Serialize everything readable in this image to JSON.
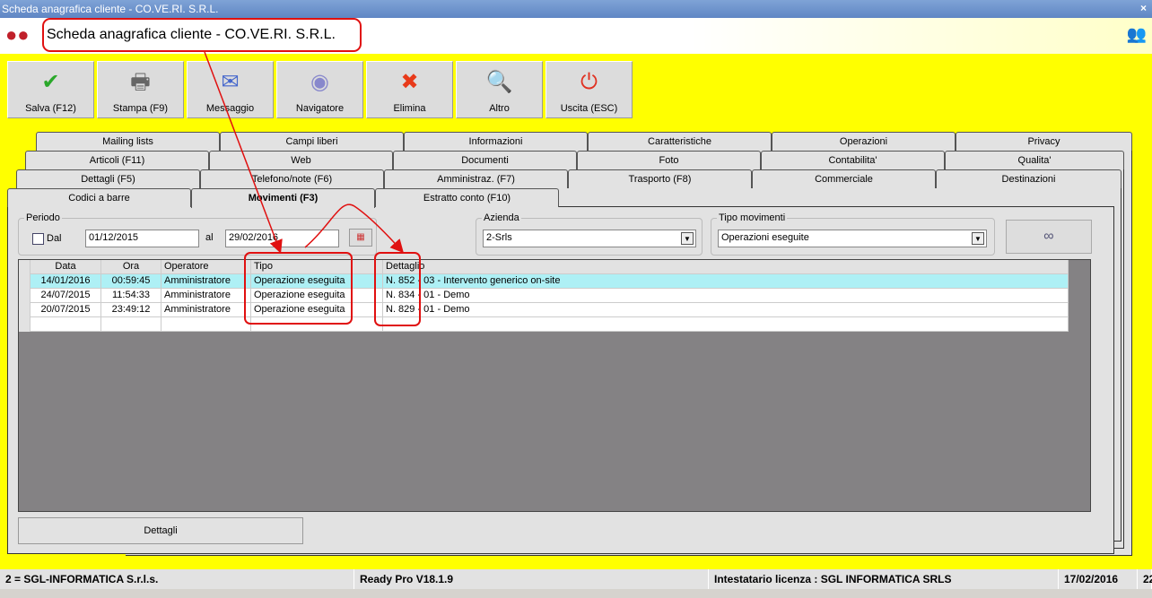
{
  "window": {
    "title": "Scheda anagrafica cliente - CO.VE.RI. S.R.L.",
    "close": "×"
  },
  "header": {
    "title": "Scheda anagrafica cliente - CO.VE.RI. S.R.L."
  },
  "toolbar": [
    {
      "label": "Salva (F12)",
      "icon": "check-icon",
      "glyph": "✔",
      "color": "#2aa82a"
    },
    {
      "label": "Stampa (F9)",
      "icon": "printer-icon",
      "glyph": "🖶",
      "color": "#666"
    },
    {
      "label": "Messaggio",
      "icon": "envelope-pen-icon",
      "glyph": "✉",
      "color": "#4466cc"
    },
    {
      "label": "Navigatore",
      "icon": "compass-icon",
      "glyph": "◉",
      "color": "#8888cc"
    },
    {
      "label": "Elimina",
      "icon": "x-icon",
      "glyph": "✖",
      "color": "#e83a1a"
    },
    {
      "label": "Altro",
      "icon": "magnifier-book-icon",
      "glyph": "🔍",
      "color": "#2a5cc8"
    },
    {
      "label": "Uscita (ESC)",
      "icon": "power-icon",
      "glyph": "⏻",
      "color": "#e03020"
    }
  ],
  "tabs": {
    "row1": [
      "Mailing lists",
      "Campi liberi",
      "Informazioni",
      "Caratteristiche",
      "Operazioni",
      "Privacy"
    ],
    "row2": [
      "Articoli (F11)",
      "Web",
      "Documenti",
      "Foto",
      "Contabilita'",
      "Qualita'"
    ],
    "row3": [
      "Dettagli (F5)",
      "Telefono/note (F6)",
      "Amministraz. (F7)",
      "Trasporto (F8)",
      "Commerciale",
      "Destinazioni"
    ],
    "row4": [
      "Codici a barre",
      "Movimenti (F3)",
      "Estratto conto (F10)"
    ]
  },
  "filters": {
    "periodo_label": "Periodo",
    "dal_label": "Dal",
    "dal_value": "01/12/2015",
    "al_label": "al",
    "al_value": "29/02/2016",
    "azienda_label": "Azienda",
    "azienda_value": "2-Srls",
    "tipo_label": "Tipo movimenti",
    "tipo_value": "Operazioni eseguite"
  },
  "grid": {
    "columns": [
      "Data",
      "Ora",
      "Operatore",
      "Tipo",
      "Dettaglio"
    ],
    "rows": [
      [
        "14/01/2016",
        "00:59:45",
        "Amministratore",
        "Operazione eseguita",
        "N. 852 - 03 - Intervento generico on-site"
      ],
      [
        "24/07/2015",
        "11:54:33",
        "Amministratore",
        "Operazione eseguita",
        "N. 834 - 01 - Demo"
      ],
      [
        "20/07/2015",
        "23:49:12",
        "Amministratore",
        "Operazione eseguita",
        "N. 829 - 01 - Demo"
      ]
    ]
  },
  "dettagli_button": "Dettagli",
  "status": {
    "company": "2 = SGL-INFORMATICA S.r.l.s.",
    "version": "Ready Pro V18.1.9",
    "license": "Intestatario licenza : SGL INFORMATICA SRLS",
    "date": "17/02/2016",
    "time": "22"
  }
}
